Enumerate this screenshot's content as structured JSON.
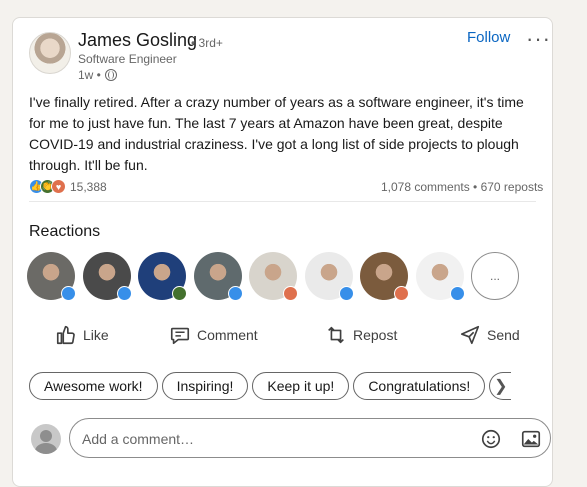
{
  "post": {
    "author": {
      "name": "James Gosling",
      "degree": "• 3rd+",
      "headline": "Software Engineer",
      "time": "1w •"
    },
    "follow_label": "Follow",
    "more_label": "···",
    "body": "I've finally retired. After a crazy number of years as a software engineer, it's time for me to just have fun. The last 7 years at Amazon have been great, despite COVID-19 and industrial craziness. I've got a long list of side projects to plough through. It'll be fun.",
    "reaction_count": "15,388",
    "comments_reposts": "1,078 comments • 670 reposts"
  },
  "reactions": {
    "title": "Reactions",
    "people": [
      {
        "badge": "like",
        "bg": "#6b6a66"
      },
      {
        "badge": "like",
        "bg": "#4a4a4a"
      },
      {
        "badge": "celebrate",
        "bg": "#1f3f7a"
      },
      {
        "badge": "like",
        "bg": "#5f6a6d"
      },
      {
        "badge": "love",
        "bg": "#d8d4cc"
      },
      {
        "badge": "like",
        "bg": "#eaeaea"
      },
      {
        "badge": "love",
        "bg": "#7b5b3d"
      },
      {
        "badge": "like",
        "bg": "#f1f1f1"
      }
    ],
    "more_label": "..."
  },
  "actions": {
    "like": "Like",
    "comment": "Comment",
    "repost": "Repost",
    "send": "Send"
  },
  "suggestions": [
    "Awesome work!",
    "Inspiring!",
    "Keep it up!",
    "Congratulations!"
  ],
  "suggestion_arrow": "❯",
  "comment_box": {
    "placeholder": "Add a comment…"
  },
  "colors": {
    "accent": "#0a66c2",
    "like": "#378fe9",
    "celebrate": "#44712e",
    "love": "#df704d"
  }
}
